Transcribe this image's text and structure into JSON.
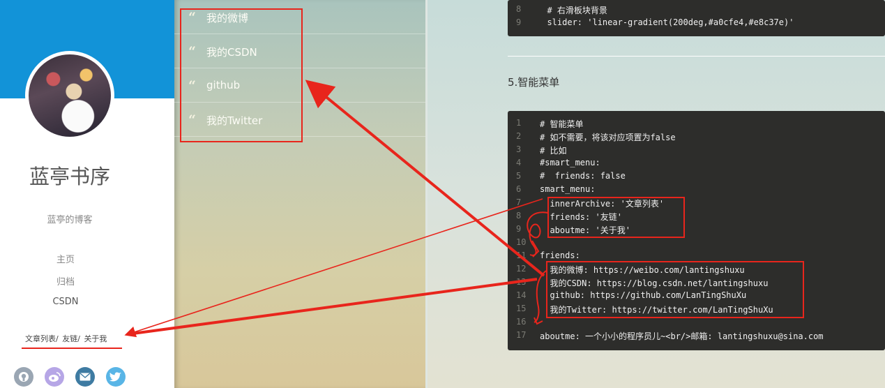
{
  "sidebar": {
    "title": "蓝亭书序",
    "subtitle": "蓝亭的博客",
    "nav": [
      "主页",
      "归档",
      "CSDN"
    ],
    "smart_menu": [
      "文章列表/",
      "友链/",
      "关于我"
    ],
    "social_icons": [
      "github-icon",
      "weibo-icon",
      "mail-icon",
      "twitter-icon"
    ]
  },
  "friends_panel": {
    "items": [
      {
        "quote": "“",
        "label": "我的微博"
      },
      {
        "quote": "“",
        "label": "我的CSDN"
      },
      {
        "quote": "“",
        "label": "github"
      },
      {
        "quote": "“",
        "label": "我的Twitter"
      }
    ]
  },
  "content": {
    "code_top": {
      "lines": [
        {
          "num": "8",
          "text": "  # 右滑板块背景"
        },
        {
          "num": "9",
          "text": "  slider: 'linear-gradient(200deg,#a0cfe4,#e8c37e)'"
        }
      ]
    },
    "section_title": "5.智能菜单",
    "code_main": {
      "lines": [
        {
          "num": "1",
          "text": "# 智能菜单"
        },
        {
          "num": "2",
          "text": "# 如不需要，将该对应项置为false"
        },
        {
          "num": "3",
          "text": "# 比如"
        },
        {
          "num": "4",
          "text": "#smart_menu:"
        },
        {
          "num": "5",
          "text": "#  friends: false"
        },
        {
          "num": "6",
          "text": "smart_menu:"
        },
        {
          "num": "7",
          "text": "  innerArchive: '文章列表'"
        },
        {
          "num": "8",
          "text": "  friends: '友链'"
        },
        {
          "num": "9",
          "text": "  aboutme: '关于我'"
        },
        {
          "num": "10",
          "text": ""
        },
        {
          "num": "11",
          "text": "friends:"
        },
        {
          "num": "12",
          "text": "  我的微博: https://weibo.com/lantingshuxu"
        },
        {
          "num": "13",
          "text": "  我的CSDN: https://blog.csdn.net/lantingshuxu"
        },
        {
          "num": "14",
          "text": "  github: https://github.com/LanTingShuXu"
        },
        {
          "num": "15",
          "text": "  我的Twitter: https://twitter.com/LanTingShuXu"
        },
        {
          "num": "16",
          "text": ""
        },
        {
          "num": "17",
          "text": "aboutme: 一个小小的程序员儿~<br/>邮箱: lantingshuxu@sina.com"
        }
      ]
    }
  },
  "colors": {
    "accent_blue": "#1293d8",
    "annotation_red": "#e8251c",
    "code_bg": "#2d2d2b"
  }
}
